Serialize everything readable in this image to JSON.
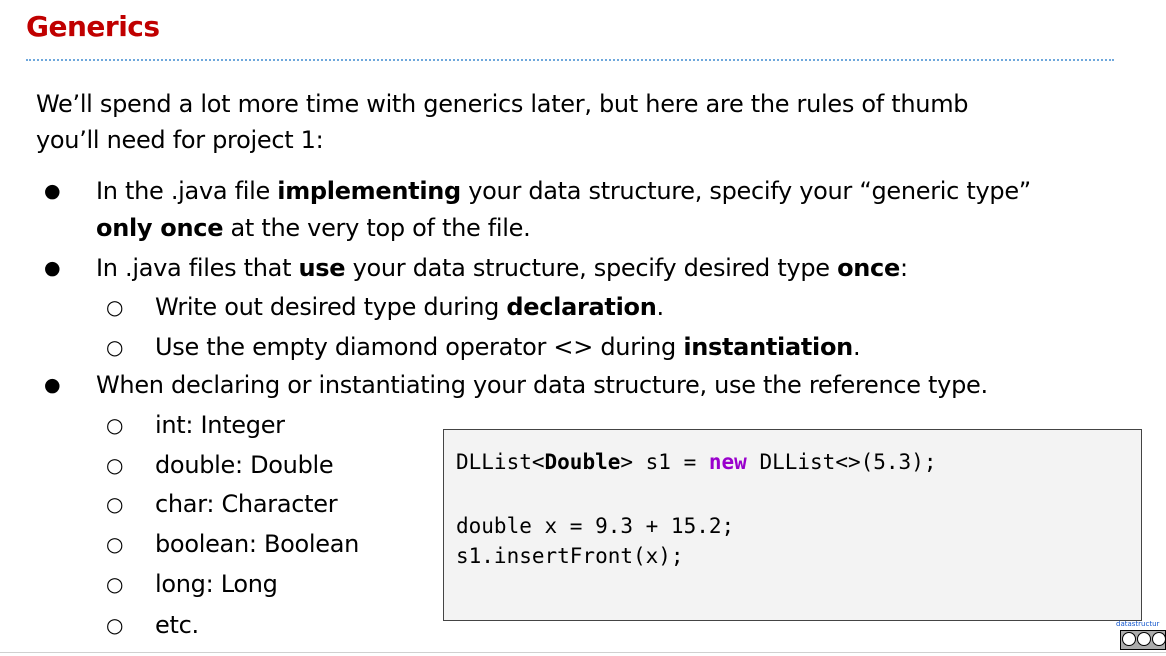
{
  "slide": {
    "title": "Generics",
    "intro_line1": "We’ll spend a lot more time with generics later, but here are the rules of thumb",
    "intro_line2": "you’ll need for project 1:",
    "bullets": [
      {
        "line1_pre": "In the .java file ",
        "line1_bold": "implementing",
        "line1_post": " your data structure, specify your “generic type”",
        "line2_bold": "only once",
        "line2_post": " at the very top of the file."
      },
      {
        "pre": "In .java files that ",
        "bold1": "use",
        "mid": " your data structure, specify desired type ",
        "bold2": "once",
        "post": ":",
        "subs": [
          {
            "pre": "Write out desired type during ",
            "bold": "declaration",
            "post": "."
          },
          {
            "pre": "Use the empty diamond operator <> during ",
            "bold": "instantiation",
            "post": "."
          }
        ]
      },
      {
        "text": "When declaring or instantiating your data structure, use the reference type.",
        "subs": [
          "int: Integer",
          "double: Double",
          "char: Character",
          "boolean: Boolean",
          "long: Long",
          "etc."
        ]
      }
    ],
    "bullet_symbol": "●",
    "sub_bullet_symbol": "○"
  },
  "code": {
    "line1_a": "DLList<",
    "line1_bold": "Double",
    "line1_b": "> s1 = ",
    "line1_kw": "new",
    "line1_c": " DLList<>(5.3);",
    "line2": "double x = 9.3 + 15.2;",
    "line3": "s1.insertFront(x);"
  },
  "footer": {
    "link_text": "datastructur",
    "license_icon": "creative-commons-by-nc-icon"
  },
  "colors": {
    "title": "#c00000",
    "divider": "#6fa8dc",
    "keyword": "#9900cc",
    "code_bg": "#f3f3f3"
  }
}
